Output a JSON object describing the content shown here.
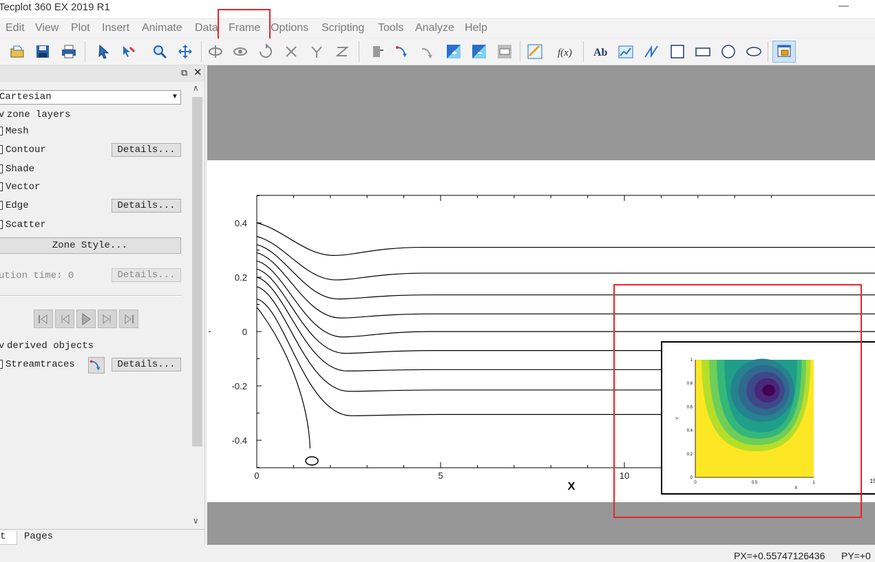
{
  "window": {
    "title": "Tecplot 360 EX 2019 R1",
    "minimize_glyph": "—"
  },
  "menu": {
    "items": [
      "Edit",
      "View",
      "Plot",
      "Insert",
      "Animate",
      "Data",
      "Frame",
      "Options",
      "Scripting",
      "Tools",
      "Analyze",
      "Help"
    ],
    "highlighted": "Frame"
  },
  "toolbar": {
    "icons": [
      "open-layout-icon",
      "save-icon",
      "print-icon",
      "select-arrow-icon",
      "adjustor-icon",
      "zoom-icon",
      "translate-icon",
      "rotate-spherical-icon",
      "rotate-rollerball-icon",
      "rotate-twist-icon",
      "rotate-x-icon",
      "rotate-y-icon",
      "rotate-z-icon",
      "probe-icon",
      "streamtrace-place-icon",
      "streamtrace-rake-icon",
      "contour-add-icon",
      "contour-remove-icon",
      "contour-label-icon",
      "slice-icon",
      "equation-icon",
      "text-icon",
      "inset-plot-icon",
      "polyline-icon",
      "square-icon",
      "rectangle-icon",
      "circle-icon",
      "ellipse-icon",
      "frame-create-icon"
    ],
    "text_tool_label": "Ab",
    "equation_label": "f(x)"
  },
  "sidebar": {
    "plot_type": "Cartesian",
    "zone_layers_header": "zone layers",
    "layers": [
      {
        "label": "Mesh",
        "details": ""
      },
      {
        "label": "Contour",
        "details": "Details..."
      },
      {
        "label": "Shade",
        "details": ""
      },
      {
        "label": "Vector",
        "details": ""
      },
      {
        "label": "Edge",
        "details": "Details..."
      },
      {
        "label": "Scatter",
        "details": ""
      }
    ],
    "zone_style_button": "Zone Style...",
    "solution_time_label": "ution time: 0",
    "solution_time_details": "Details...",
    "derived_header": "derived objects",
    "streamtraces_label": "Streamtraces",
    "streamtraces_details": "Details...",
    "tabs": [
      "t",
      "Pages"
    ]
  },
  "status": {
    "px": "PX=+0.55747126436",
    "py": "PY=+0"
  },
  "chart_data": {
    "type": "line",
    "xlabel": "X",
    "ylabel": "",
    "xlim": [
      0,
      15
    ],
    "ylim": [
      -0.5,
      0.5
    ],
    "x_ticks": [
      0,
      5,
      10
    ],
    "y_ticks": [
      0.4,
      0.2,
      0,
      -0.2,
      -0.4
    ],
    "y_tick_labels": [
      "0.4",
      "0.2",
      "0",
      "-0.2",
      "-0.4"
    ],
    "series": [
      {
        "start_y": 0.4,
        "dip_y": 0.28,
        "end_y": 0.31
      },
      {
        "start_y": 0.35,
        "dip_y": 0.19,
        "end_y": 0.215
      },
      {
        "start_y": 0.32,
        "dip_y": 0.12,
        "end_y": 0.135
      },
      {
        "start_y": 0.29,
        "dip_y": 0.05,
        "end_y": 0.065
      },
      {
        "start_y": 0.26,
        "dip_y": -0.02,
        "end_y": 0.0
      },
      {
        "start_y": 0.23,
        "dip_y": -0.08,
        "end_y": -0.07
      },
      {
        "start_y": 0.2,
        "dip_y": -0.145,
        "end_y": -0.14
      },
      {
        "start_y": 0.165,
        "dip_y": -0.22,
        "end_y": -0.215
      },
      {
        "start_y": 0.12,
        "dip_y": -0.31,
        "end_y": -0.305
      }
    ],
    "inset": {
      "type": "heatmap",
      "xlabel": "X",
      "ylabel": "Y",
      "x_ticks": [
        "0",
        "0.5",
        "1",
        "15"
      ],
      "y_ticks": [
        "1",
        "0.8",
        "0.6",
        "0.4",
        "0.2",
        "0"
      ],
      "levels": 10,
      "colors": [
        "#fde725",
        "#b5de2b",
        "#6ece58",
        "#35b779",
        "#1f9e89",
        "#26828e",
        "#31688e",
        "#3e4989",
        "#482878",
        "#440154"
      ]
    }
  },
  "colors": {
    "highlight": "#e5252a",
    "workspace": "#979797",
    "frame": "#ffffff"
  }
}
